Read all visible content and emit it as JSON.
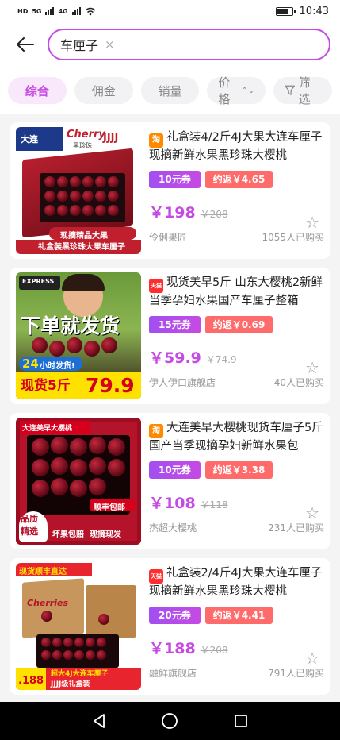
{
  "status_bar": {
    "left_labels": [
      "HD",
      "5G",
      "4G"
    ],
    "time": "10:43"
  },
  "search": {
    "query": "车厘子",
    "clear_icon": "×"
  },
  "filters": [
    {
      "label": "综合",
      "active": true
    },
    {
      "label": "佣金",
      "active": false
    },
    {
      "label": "销量",
      "active": false
    },
    {
      "label": "价格",
      "active": false
    },
    {
      "label": "筛选",
      "active": false
    }
  ],
  "products": [
    {
      "platform": "淘",
      "title": "礼盒装4/2斤4J大果大连车厘子现摘新鲜水果黑珍珠大樱桃",
      "coupon": "10元券",
      "rebate": "约返￥4.65",
      "price": "￥198",
      "original_price": "￥208",
      "shop": "伶俐果匠",
      "sales": "1055人已购买",
      "thumb": {
        "tag": "大连",
        "brand": "Cherry",
        "brand_sub": "黑珍珠",
        "grade": "JJJJ",
        "ribbon": "现摘精品大果",
        "caption": "礼盒装黑珍珠大果车厘子"
      }
    },
    {
      "platform": "天猫",
      "title": "现货美早5斤 山东大樱桃2新鲜当季孕妇水果国产车厘子整箱",
      "coupon": "15元券",
      "rebate": "约返￥0.69",
      "price": "￥59.9",
      "original_price": "￥74.9",
      "shop": "伊人伊口旗舰店",
      "sales": "40人已购买",
      "thumb": {
        "badge": "EXPRESS",
        "headline": "下单就发货",
        "hours": "24",
        "hours_note": "小时发货!",
        "stock": "现货5斤",
        "price": "79.9"
      }
    },
    {
      "platform": "淘",
      "title": "大连美早大樱桃现货车厘子5斤国产当季现摘孕妇新鲜水果包",
      "coupon": "10元券",
      "rebate": "约返￥3.38",
      "price": "￥108",
      "original_price": "￥118",
      "shop": "杰超大樱桃",
      "sales": "231人已购买",
      "thumb": {
        "tag": "大连美早大樱桃",
        "shipping": "顺丰包邮",
        "quality": "品质\n精选",
        "bottom": "坏果包赔  现摘现发"
      }
    },
    {
      "platform": "天猫",
      "title": "礼盒装2/4斤4J大果大连车厘子现摘新鲜水果黑珍珠大樱桃",
      "coupon": "20元券",
      "rebate": "约返￥4.41",
      "price": "￥188",
      "original_price": "￥208",
      "shop": "融鲜旗舰店",
      "sales": "791人已购买",
      "thumb": {
        "tag": "现货顺丰直达",
        "box_label": "Cherries",
        "bottom": "超大4J大连车厘子",
        "grade_line": "JJJJ级礼盒装",
        "price_tag": ".188"
      }
    }
  ]
}
